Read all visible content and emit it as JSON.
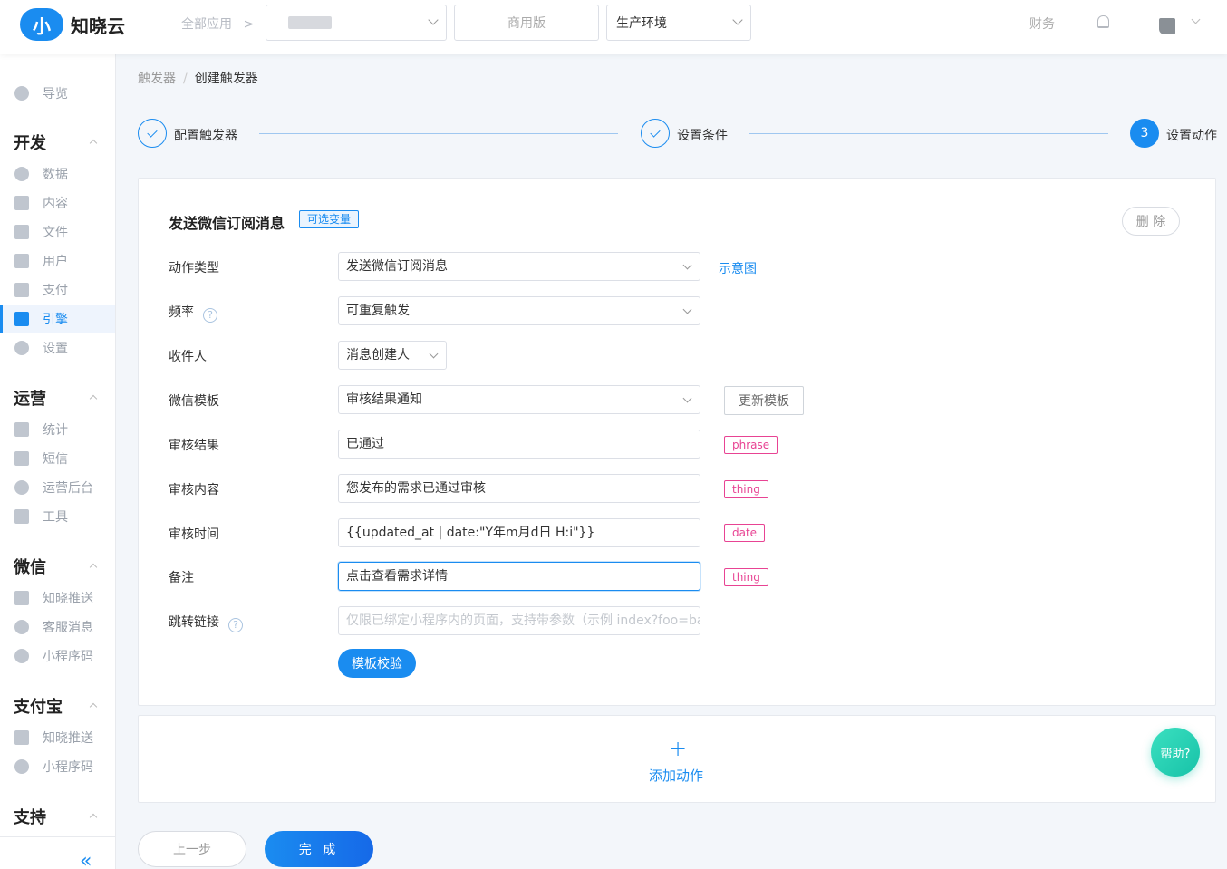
{
  "header": {
    "logo_mark": "小",
    "logo_text": "知晓云",
    "all_apps": "全部应用",
    "plan_label": "商用版",
    "env_label": "生产环境",
    "finance": "财务"
  },
  "sidebar": {
    "items": [
      {
        "label": "导览",
        "icon": "grid-icon"
      },
      {
        "label": "数据",
        "icon": "pie-chart-icon"
      },
      {
        "label": "内容",
        "icon": "document-icon"
      },
      {
        "label": "文件",
        "icon": "folder-icon"
      },
      {
        "label": "用户",
        "icon": "user-icon"
      },
      {
        "label": "支付",
        "icon": "wallet-icon"
      },
      {
        "label": "引擎",
        "icon": "trend-icon"
      },
      {
        "label": "设置",
        "icon": "gear-icon"
      },
      {
        "label": "统计",
        "icon": "bar-chart-icon"
      },
      {
        "label": "短信",
        "icon": "mail-icon"
      },
      {
        "label": "运营后台",
        "icon": "dashboard-icon"
      },
      {
        "label": "工具",
        "icon": "wrench-icon"
      },
      {
        "label": "知晓推送",
        "icon": "layout-icon"
      },
      {
        "label": "客服消息",
        "icon": "headset-icon"
      },
      {
        "label": "小程序码",
        "icon": "qrcode-icon"
      },
      {
        "label": "知晓推送",
        "icon": "layout-icon"
      },
      {
        "label": "小程序码",
        "icon": "qrcode-icon"
      }
    ],
    "groups": [
      "开发",
      "运营",
      "微信",
      "支付宝",
      "支持"
    ],
    "collapse_glyph": "«"
  },
  "breadcrumb": {
    "parent": "触发器",
    "separator": "/",
    "current": "创建触发器"
  },
  "steps": [
    {
      "label": "配置触发器"
    },
    {
      "label": "设置条件"
    },
    {
      "number": "3",
      "label": "设置动作"
    }
  ],
  "action_card": {
    "title": "发送微信订阅消息",
    "vars_tag": "可选变量",
    "delete_label": "删 除",
    "demo_link": "示意图",
    "update_template": "更新模板",
    "validate": "模板校验",
    "fields": {
      "action_type": {
        "label": "动作类型",
        "value": "发送微信订阅消息"
      },
      "frequency": {
        "label": "频率",
        "value": "可重复触发"
      },
      "recipient": {
        "label": "收件人",
        "value": "消息创建人"
      },
      "template": {
        "label": "微信模板",
        "value": "审核结果通知"
      },
      "result": {
        "label": "审核结果",
        "value": "已通过",
        "type": "phrase"
      },
      "content": {
        "label": "审核内容",
        "value": "您发布的需求已通过审核",
        "type": "thing"
      },
      "time": {
        "label": "审核时间",
        "value": "{{updated_at | date:\"Y年m月d日 H:i\"}}",
        "type": "date"
      },
      "remark": {
        "label": "备注",
        "value": "点击查看需求详情",
        "type": "thing"
      },
      "link": {
        "label": "跳转链接",
        "placeholder": "仅限已绑定小程序内的页面，支持带参数（示例 index?foo=ba"
      }
    },
    "help_glyph": "?"
  },
  "add_action": {
    "plus": "+",
    "label": "添加动作"
  },
  "help_fab": "帮助?",
  "footer": {
    "prev": "上一步",
    "done": "完 成"
  },
  "colors": {
    "accent": "#1a8cf0",
    "tag_pink": "#e84393",
    "help_teal": "#17c2a8"
  }
}
